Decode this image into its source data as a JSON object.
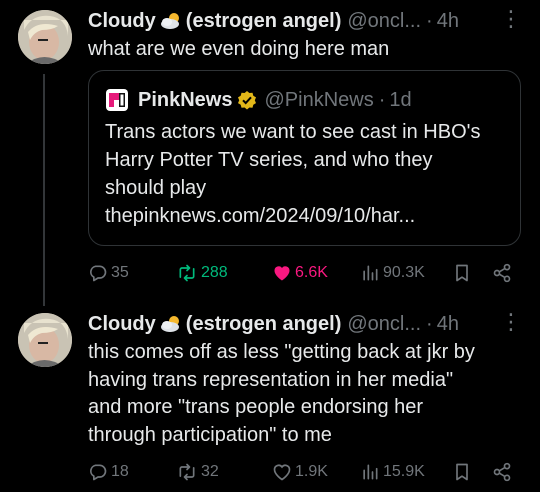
{
  "tweets": [
    {
      "name": "Cloudy",
      "display_suffix": "(estrogen angel)",
      "handle": "@oncl...",
      "dot": "·",
      "time": "4h",
      "text": "what are we even doing here man",
      "quote": {
        "name": "PinkNews",
        "handle": "@PinkNews",
        "dot": "·",
        "time": "1d",
        "text_lines": [
          "Trans actors we want to see cast in HBO's",
          "Harry Potter TV series, and who they",
          "should play",
          "thepinknews.com/2024/09/10/har..."
        ]
      },
      "actions": {
        "replies": "35",
        "reposts": "288",
        "likes": "6.6K",
        "views": "90.3K"
      }
    },
    {
      "name": "Cloudy",
      "display_suffix": "(estrogen angel)",
      "handle": "@oncl...",
      "dot": "·",
      "time": "4h",
      "text_lines": [
        "this comes off as less \"getting back at jkr by",
        "having trans representation in her media\"",
        "and more \"trans people endorsing her",
        "through participation\" to me"
      ],
      "actions": {
        "replies": "18",
        "reposts": "32",
        "likes": "1.9K",
        "views": "15.9K"
      }
    }
  ],
  "colors": {
    "background": "#000000",
    "text": "#e7e9ea",
    "muted": "#71767b",
    "repost_active": "#00ba7c",
    "like_active": "#f91880",
    "verified": "#e2b719"
  },
  "icons": [
    "cloud-sun-icon",
    "reply-icon",
    "repost-icon",
    "like-icon",
    "views-icon",
    "bookmark-icon",
    "share-icon",
    "more-icon",
    "verified-badge-icon",
    "pinknews-logo"
  ]
}
